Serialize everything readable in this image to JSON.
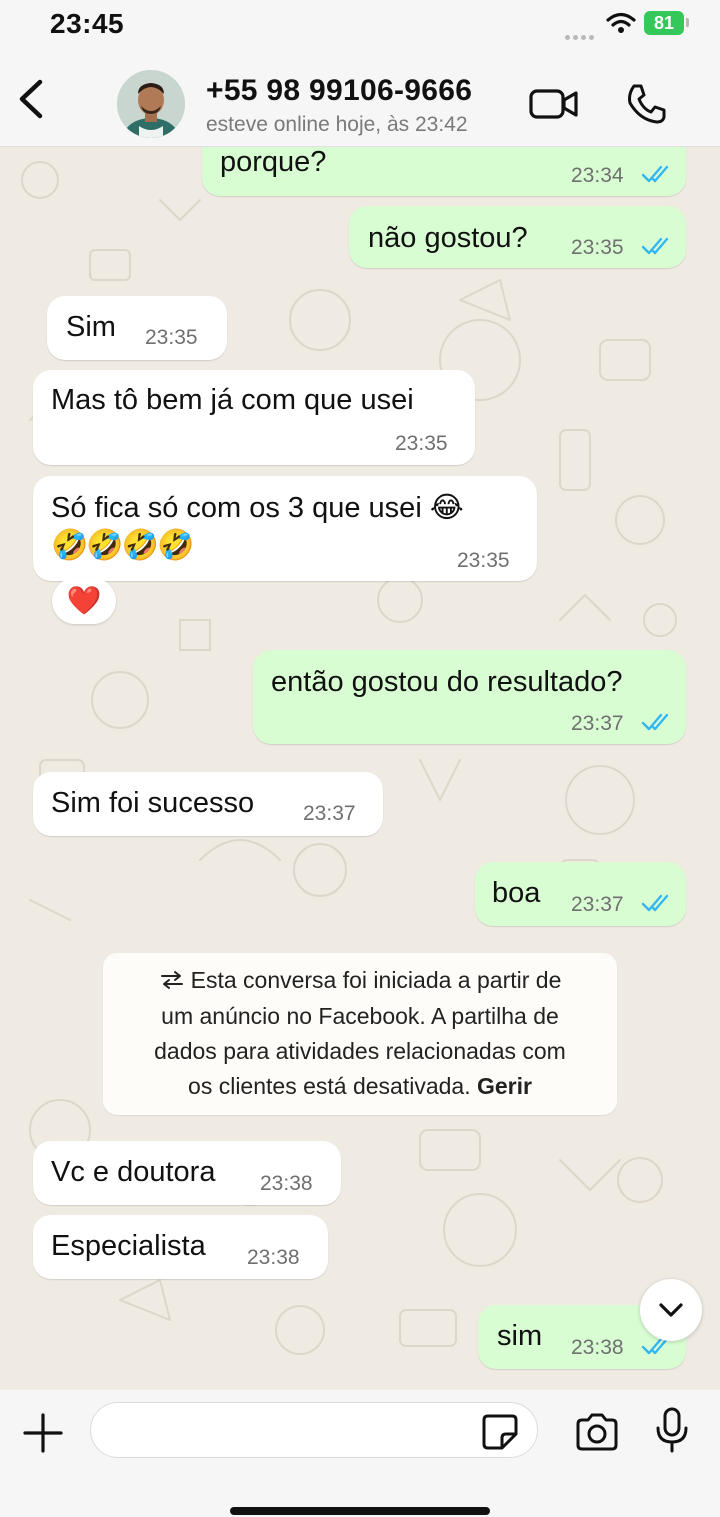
{
  "status_bar": {
    "time": "23:45",
    "battery": "81"
  },
  "header": {
    "contact_name": "+55 98 99106-9666",
    "contact_status": "esteve online hoje, às 23:42",
    "icons": [
      "back-chevron-icon",
      "video-call-icon",
      "phone-icon"
    ]
  },
  "messages": [
    {
      "dir": "out",
      "text": "porque?",
      "time": "23:34",
      "status": "read"
    },
    {
      "dir": "out",
      "text": "não gostou?",
      "time": "23:35",
      "status": "read"
    },
    {
      "dir": "in",
      "text": "Sim",
      "time": "23:35"
    },
    {
      "dir": "in",
      "text": "Mas tô bem já com que usei",
      "time": "23:35"
    },
    {
      "dir": "in",
      "text_line1": "Só fica só com os 3 que usei 😂",
      "text_line2": "🤣🤣🤣🤣",
      "time": "23:35",
      "reaction": "❤️"
    },
    {
      "dir": "out",
      "text": "então gostou do resultado?",
      "time": "23:37",
      "status": "read"
    },
    {
      "dir": "in",
      "text": "Sim foi sucesso",
      "time": "23:37"
    },
    {
      "dir": "out",
      "text": "boa",
      "time": "23:37",
      "status": "read"
    },
    {
      "dir": "in",
      "text": "Vc e doutora",
      "time": "23:38"
    },
    {
      "dir": "in",
      "text": "Especialista",
      "time": "23:38"
    },
    {
      "dir": "out",
      "text": "sim",
      "time": "23:38",
      "status": "read"
    }
  ],
  "system_notice": {
    "icon": "transfer-arrows-icon",
    "line1": "Esta conversa foi iniciada a partir de",
    "line2": "um anúncio no Facebook. A partilha de",
    "line3": "dados para atividades relacionadas com",
    "line4": "os clientes está desativada.",
    "link": "Gerir"
  },
  "composer": {
    "placeholder": ""
  },
  "colors": {
    "outgoing_bubble": "#d9fdd3",
    "incoming_bubble": "#ffffff",
    "read_ticks": "#34b7f1",
    "wallpaper": "#efeae2"
  }
}
